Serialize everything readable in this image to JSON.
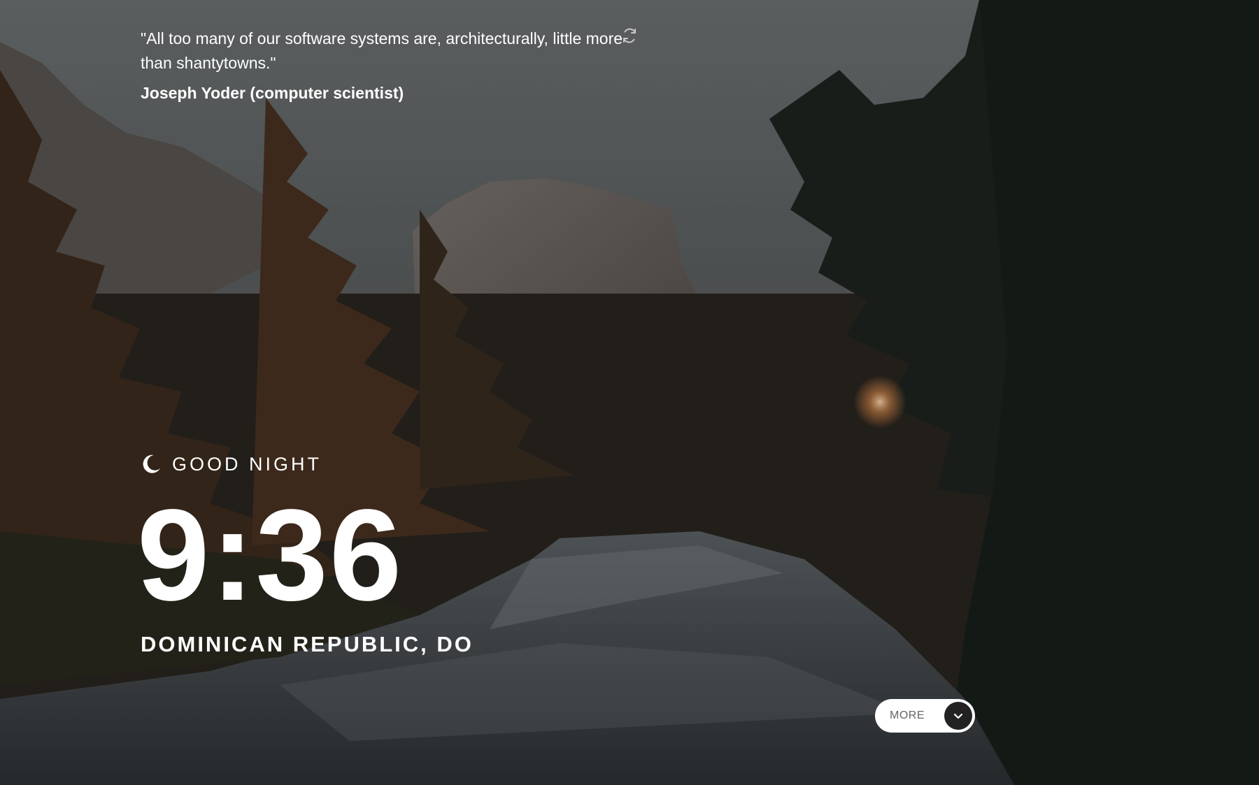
{
  "quote": {
    "text": "\"All too many of our software systems are, architecturally, little more than shantytowns.\"",
    "author": "Joseph Yoder (computer scientist)",
    "refresh_icon": "refresh-icon"
  },
  "greeting": {
    "icon": "moon-icon",
    "text": "GOOD NIGHT"
  },
  "clock": {
    "time": "9:36"
  },
  "location": {
    "text": "DOMINICAN REPUBLIC, DO"
  },
  "more_button": {
    "label": "MORE",
    "icon": "chevron-down-icon"
  },
  "colors": {
    "text": "#ffffff",
    "button_bg": "#ffffff",
    "button_text": "#666666",
    "chevron_bg": "#222222"
  }
}
